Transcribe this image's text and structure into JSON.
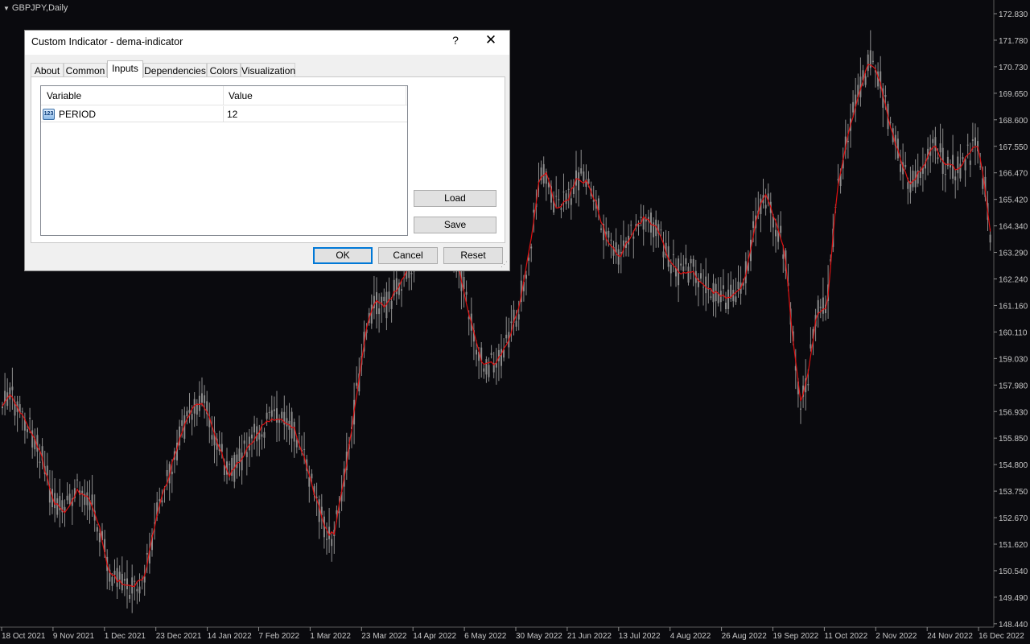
{
  "chart": {
    "symbol": "GBPJPY,Daily",
    "price_labels": [
      "172.830",
      "171.780",
      "170.730",
      "169.650",
      "168.600",
      "167.550",
      "166.470",
      "165.420",
      "164.340",
      "163.290",
      "162.240",
      "161.160",
      "160.110",
      "159.030",
      "157.980",
      "156.930",
      "155.850",
      "154.800",
      "153.750",
      "152.670",
      "151.620",
      "150.540",
      "149.490",
      "148.440"
    ],
    "date_labels": [
      "18 Oct 2021",
      "9 Nov 2021",
      "1 Dec 2021",
      "23 Dec 2021",
      "14 Jan 2022",
      "7 Feb 2022",
      "1 Mar 2022",
      "23 Mar 2022",
      "14 Apr 2022",
      "6 May 2022",
      "30 May 2022",
      "21 Jun 2022",
      "13 Jul 2022",
      "4 Aug 2022",
      "26 Aug 2022",
      "19 Sep 2022",
      "11 Oct 2022",
      "2 Nov 2022",
      "24 Nov 2022",
      "16 Dec 2022"
    ],
    "colors": {
      "background": "#0a0a0e",
      "candle": "#8c8c8c",
      "indicator": "#e01010",
      "axis_text": "#c8c8c8"
    }
  },
  "dialog": {
    "title": "Custom Indicator - dema-indicator",
    "help": "?",
    "close": "✕",
    "tabs": [
      "About",
      "Common",
      "Inputs",
      "Dependencies",
      "Colors",
      "Visualization"
    ],
    "active_tab": "Inputs",
    "table": {
      "headers": [
        "Variable",
        "Value"
      ],
      "rows": [
        {
          "icon": "123",
          "variable": "PERIOD",
          "value": "12"
        }
      ]
    },
    "load_label": "Load",
    "save_label": "Save",
    "ok_label": "OK",
    "cancel_label": "Cancel",
    "reset_label": "Reset"
  }
}
